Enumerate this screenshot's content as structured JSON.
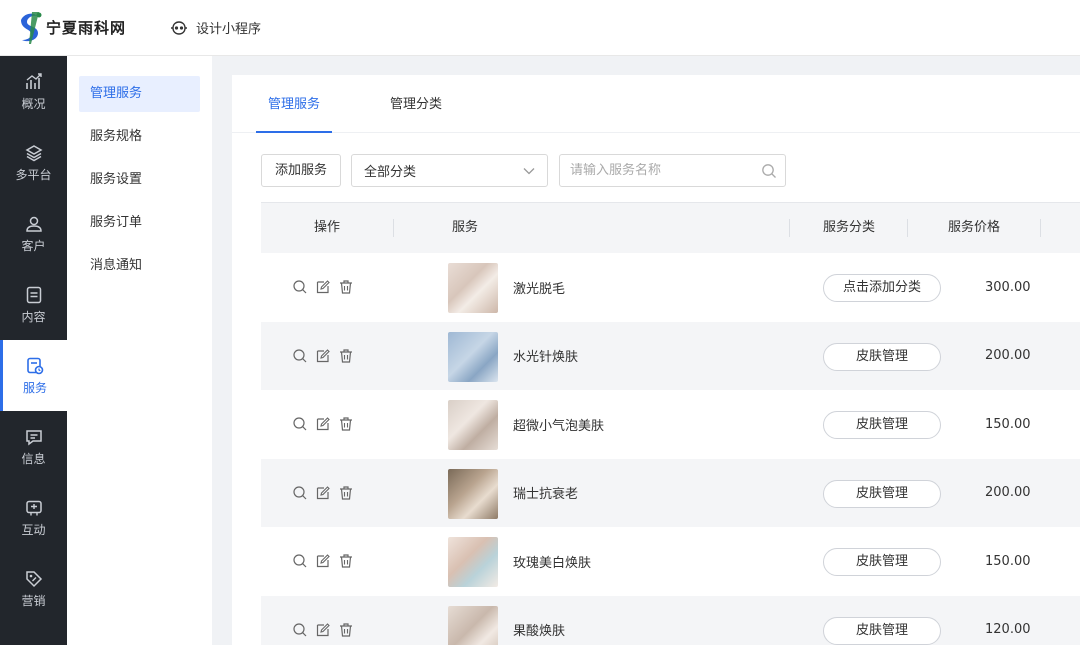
{
  "brand": {
    "name": "宁夏雨科网"
  },
  "header": {
    "design_link": "设计小程序"
  },
  "nav": [
    {
      "label": "概况",
      "icon": "overview-chart-icon"
    },
    {
      "label": "多平台",
      "icon": "layers-icon"
    },
    {
      "label": "客户",
      "icon": "user-icon"
    },
    {
      "label": "内容",
      "icon": "document-icon"
    },
    {
      "label": "服务",
      "icon": "service-icon",
      "active": true
    },
    {
      "label": "信息",
      "icon": "message-icon"
    },
    {
      "label": "互动",
      "icon": "interaction-icon"
    },
    {
      "label": "营销",
      "icon": "tag-icon"
    }
  ],
  "submenu": [
    {
      "label": "管理服务",
      "active": true
    },
    {
      "label": "服务规格"
    },
    {
      "label": "服务设置"
    },
    {
      "label": "服务订单"
    },
    {
      "label": "消息通知"
    }
  ],
  "tabs": [
    {
      "label": "管理服务",
      "active": true
    },
    {
      "label": "管理分类"
    }
  ],
  "toolbar": {
    "add_label": "添加服务",
    "category_selected": "全部分类",
    "search_placeholder": "请输入服务名称"
  },
  "table": {
    "columns": {
      "ops": "操作",
      "service": "服务",
      "category": "服务分类",
      "price": "服务价格"
    },
    "rows": [
      {
        "name": "激光脱毛",
        "category": "点击添加分类",
        "price": "300.00"
      },
      {
        "name": "水光针焕肤",
        "category": "皮肤管理",
        "price": "200.00"
      },
      {
        "name": "超微小气泡美肤",
        "category": "皮肤管理",
        "price": "150.00"
      },
      {
        "name": "瑞士抗衰老",
        "category": "皮肤管理",
        "price": "200.00"
      },
      {
        "name": "玫瑰美白焕肤",
        "category": "皮肤管理",
        "price": "150.00"
      },
      {
        "name": "果酸焕肤",
        "category": "皮肤管理",
        "price": "120.00"
      }
    ]
  },
  "colors": {
    "accent": "#2d6ee8",
    "nav_bg": "#22262c",
    "row_alt": "#f4f5f7"
  }
}
